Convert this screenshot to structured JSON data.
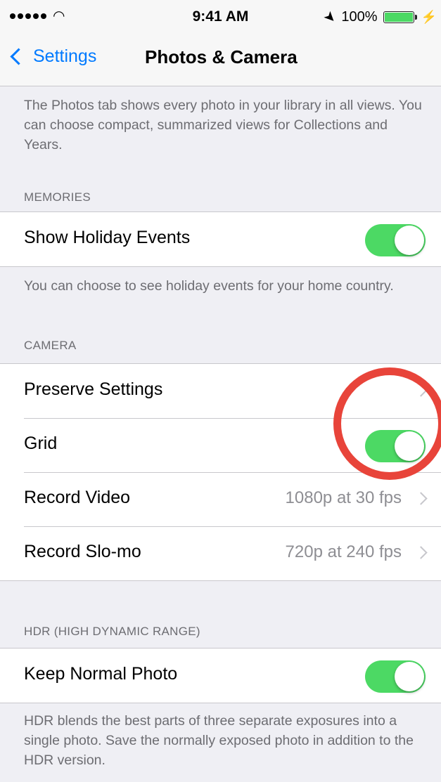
{
  "status_bar": {
    "time": "9:41 AM",
    "battery": "100%"
  },
  "nav": {
    "back_label": "Settings",
    "title": "Photos & Camera"
  },
  "intro_text": "The Photos tab shows every photo in your library in all views. You can choose compact, summarized views for Collections and Years.",
  "memories": {
    "header": "MEMORIES",
    "rows": [
      {
        "label": "Show Holiday Events",
        "toggle_on": true
      }
    ],
    "footer": "You can choose to see holiday events for your home country."
  },
  "camera": {
    "header": "CAMERA",
    "rows": [
      {
        "label": "Preserve Settings",
        "type": "disclosure"
      },
      {
        "label": "Grid",
        "type": "toggle",
        "toggle_on": true
      },
      {
        "label": "Record Video",
        "type": "disclosure",
        "value": "1080p at 30 fps"
      },
      {
        "label": "Record Slo-mo",
        "type": "disclosure",
        "value": "720p at 240 fps"
      }
    ]
  },
  "hdr": {
    "header": "HDR (HIGH DYNAMIC RANGE)",
    "rows": [
      {
        "label": "Keep Normal Photo",
        "toggle_on": true
      }
    ],
    "footer": "HDR blends the best parts of three separate exposures into a single photo. Save the normally exposed photo in addition to the HDR version."
  },
  "colors": {
    "accent": "#007aff",
    "toggle_on": "#4cd964",
    "annotation": "#e8443a"
  },
  "icons": [
    "signal-dots",
    "wifi-icon",
    "location-arrow-icon",
    "battery-icon",
    "charging-bolt-icon",
    "chevron-left-icon",
    "chevron-right-icon"
  ]
}
